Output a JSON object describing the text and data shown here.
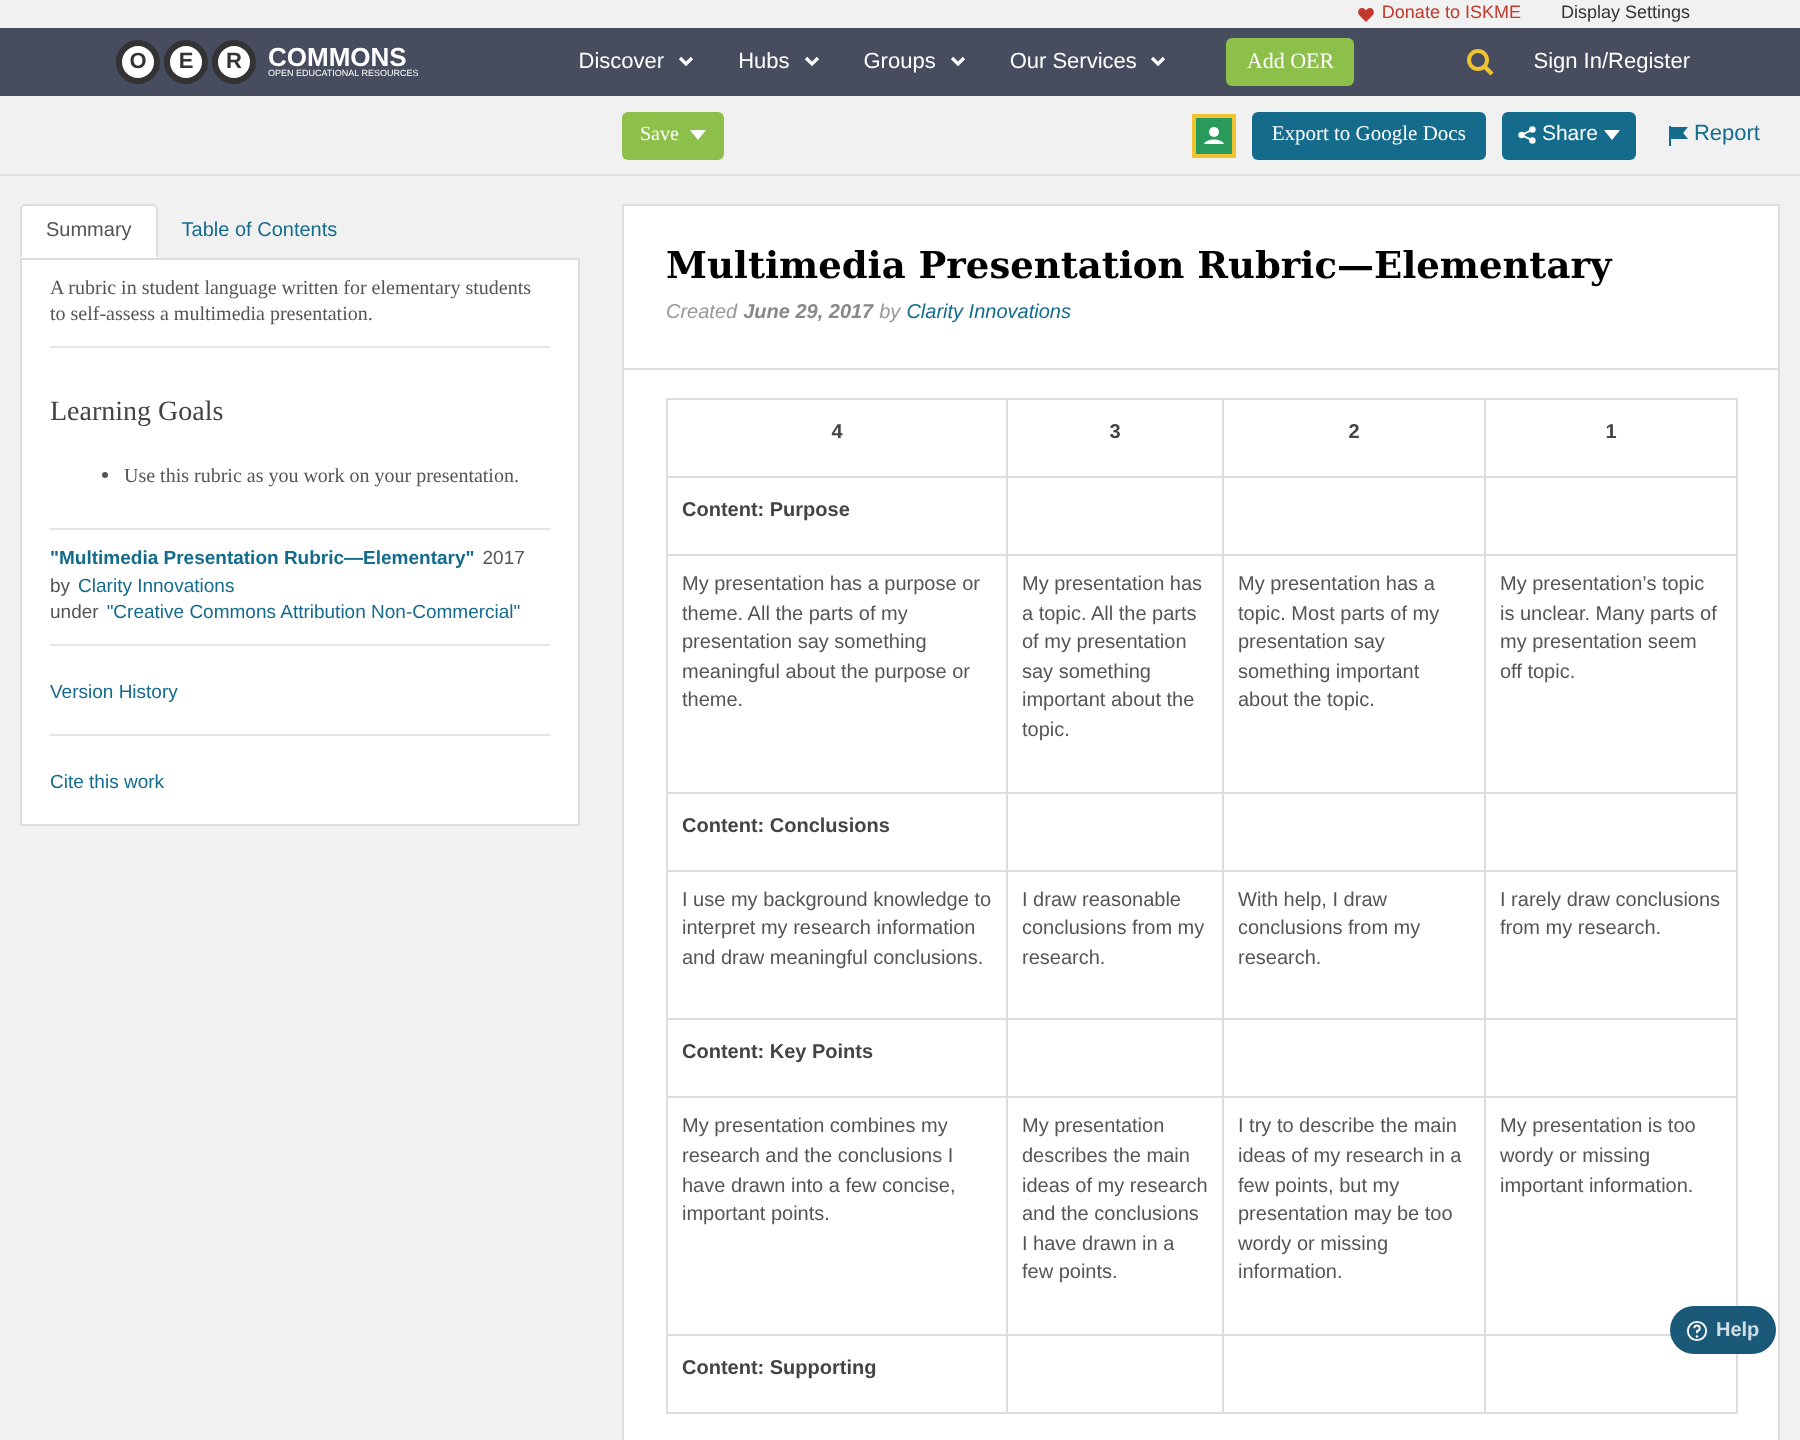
{
  "utility_bar": {
    "donate": "Donate to ISKME",
    "settings": "Display Settings"
  },
  "nav": {
    "logo_letters": [
      "O",
      "E",
      "R"
    ],
    "logo_name": "COMMONS",
    "logo_tagline": "OPEN EDUCATIONAL RESOURCES",
    "items": [
      {
        "label": "Discover"
      },
      {
        "label": "Hubs"
      },
      {
        "label": "Groups"
      },
      {
        "label": "Our Services"
      }
    ],
    "add_button": "Add OER",
    "sign_in": "Sign In/Register"
  },
  "toolbar": {
    "save": "Save",
    "export": "Export to Google Docs",
    "share": "Share",
    "report": "Report"
  },
  "sidebar": {
    "tabs": [
      {
        "label": "Summary",
        "selected": true
      },
      {
        "label": "Table of Contents",
        "selected": false
      }
    ],
    "summary": "A rubric in student language written for elementary students to self-assess a multimedia presentation.",
    "goals_title": "Learning Goals",
    "goals": [
      "Use this rubric as you work on your presentation."
    ],
    "attribution": {
      "title": "\"Multimedia Presentation Rubric—Elementary\"",
      "year": "2017",
      "by": "by",
      "author": "Clarity Innovations",
      "under": "under",
      "license": "\"Creative Commons Attribution Non-Commercial\""
    },
    "links": [
      "Version History",
      "Cite this work"
    ]
  },
  "document": {
    "title": "Multimedia Presentation Rubric—Elementary",
    "created_label": "Created",
    "date": "June 29, 2017",
    "by": "by",
    "author": "Clarity Innovations",
    "table": {
      "columns": [
        "4",
        "3",
        "2",
        "1"
      ],
      "rows": [
        {
          "kind": "label",
          "text": "Content: Purpose"
        },
        {
          "kind": "text",
          "cells": [
            "My presentation has a purpose or theme. All the parts of my presentation say something meaningful about the purpose or theme.",
            "My presentation has a topic. All the parts of my presentation say something important about the topic.",
            "My presentation has a topic. Most parts of my presentation say something important about the topic.",
            "My presentation’s topic is unclear. Many parts of my presentation seem off topic."
          ]
        },
        {
          "kind": "label",
          "text": "Content: Conclusions"
        },
        {
          "kind": "text",
          "cells": [
            "I use my background knowledge to interpret my research information and draw meaningful conclusions.",
            "I draw reasonable conclusions from my research.",
            "With help, I draw conclusions from my research.",
            "I rarely draw conclusions from my research."
          ]
        },
        {
          "kind": "label",
          "text": "Content: Key Points"
        },
        {
          "kind": "text",
          "cells": [
            "My presentation combines my research and the conclusions I have drawn into a few concise, important points.",
            "My presentation describes the main ideas of my research and the conclusions I have drawn in a few points.",
            "I try to describe the main ideas of my research in a few points, but my presentation may be too wordy or missing information.",
            "My presentation is too wordy or missing important information."
          ]
        },
        {
          "kind": "label",
          "text": "Content: Supporting"
        }
      ]
    }
  },
  "help_button": "Help"
}
